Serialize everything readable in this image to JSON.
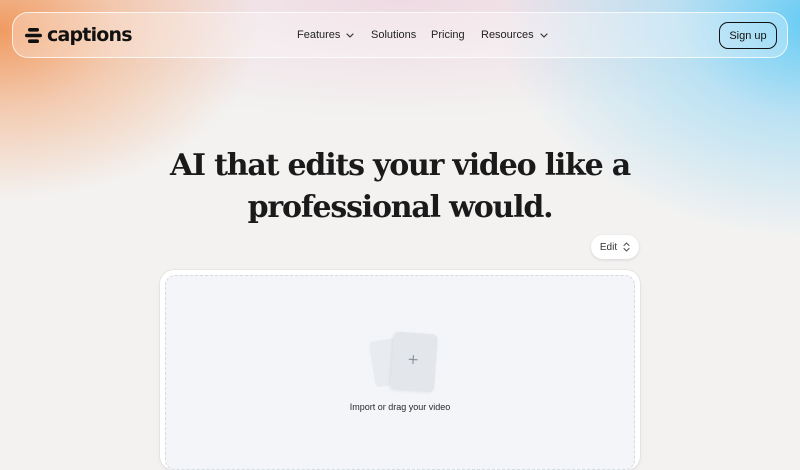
{
  "brand": {
    "name": "captions",
    "icon": "captions-logo-icon"
  },
  "nav": {
    "items": [
      {
        "label": "Features",
        "has_dropdown": true
      },
      {
        "label": "Solutions",
        "has_dropdown": false
      },
      {
        "label": "Pricing",
        "has_dropdown": false
      },
      {
        "label": "Resources",
        "has_dropdown": true
      }
    ],
    "signup_label": "Sign up"
  },
  "hero": {
    "title_line1": "AI that edits your video like a",
    "title_line2": "professional would."
  },
  "editor": {
    "mode_label": "Edit",
    "mode_icon": "chevron-updown-icon",
    "drop_label": "Import or drag your video",
    "upload_icon": "plus-icon"
  },
  "colors": {
    "text": "#1a1a1a",
    "panel": "#ffffff",
    "drop_zone": "#f3f5f8",
    "gradient_left": "#f0965a",
    "gradient_right": "#5ac8f5"
  }
}
